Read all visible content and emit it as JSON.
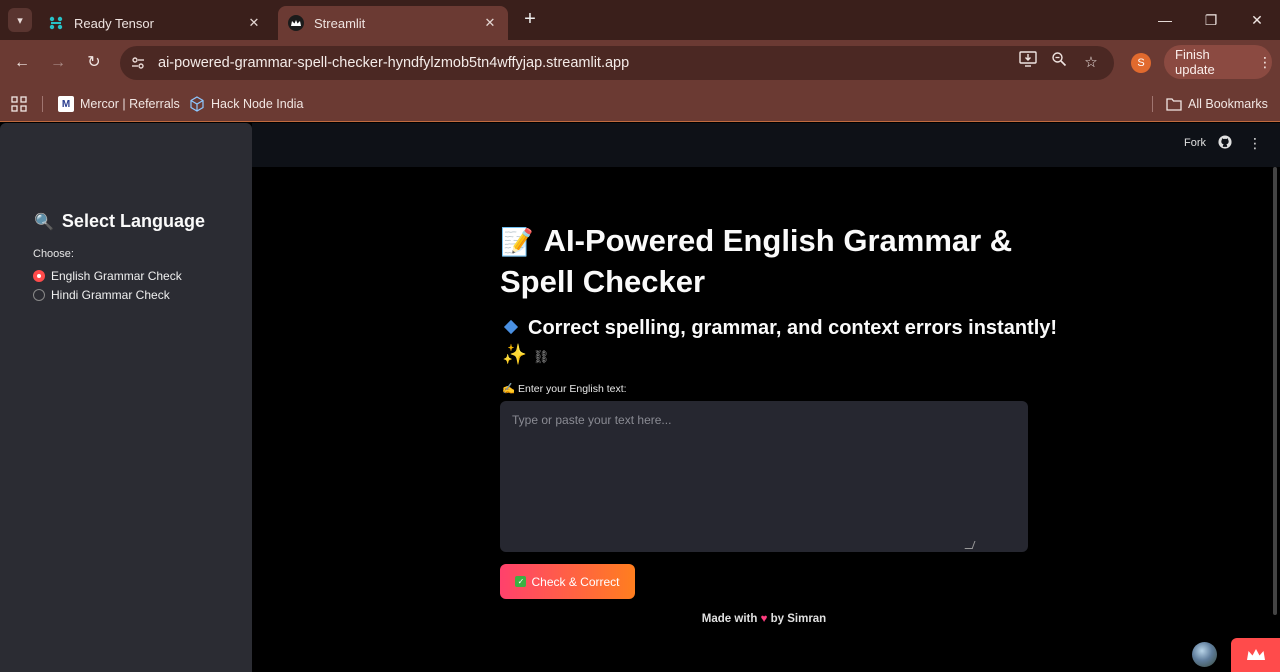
{
  "browser": {
    "tabs": [
      {
        "title": "Ready Tensor",
        "favicon": "ready-tensor-icon",
        "active": false
      },
      {
        "title": "Streamlit",
        "favicon": "streamlit-crown-icon",
        "active": true
      }
    ],
    "url": "ai-powered-grammar-spell-checker-hyndfylzmob5tn4wffyjap.streamlit.app",
    "profile_initial": "S",
    "update_button": "Finish update",
    "bookmarks": [
      {
        "label": "Mercor | Referrals",
        "icon": "M"
      },
      {
        "label": "Hack Node India",
        "icon": "cube-icon"
      }
    ],
    "all_bookmarks": "All Bookmarks"
  },
  "app": {
    "header": {
      "fork": "Fork"
    },
    "sidebar": {
      "title_emoji": "🔍",
      "title": "Select Language",
      "choose_label": "Choose:",
      "options": [
        {
          "label": "English Grammar Check",
          "selected": true
        },
        {
          "label": "Hindi Grammar Check",
          "selected": false
        }
      ]
    },
    "main": {
      "title_emoji": "📝",
      "title": "AI-Powered English Grammar & Spell Checker",
      "subtitle": "Correct spelling, grammar, and context errors instantly!",
      "subtitle_emoji": "✨",
      "input_label_emoji": "✍️",
      "input_label": "Enter your English text:",
      "input_placeholder": "Type or paste your text here...",
      "input_value": "",
      "button_label": "Check & Correct",
      "footer_prefix": "Made with",
      "footer_heart": "♥",
      "footer_suffix": "by Simran"
    },
    "colors": {
      "accent": "#ff4b4b",
      "sidebar_bg": "#2b2c33",
      "input_bg": "#262730"
    }
  }
}
